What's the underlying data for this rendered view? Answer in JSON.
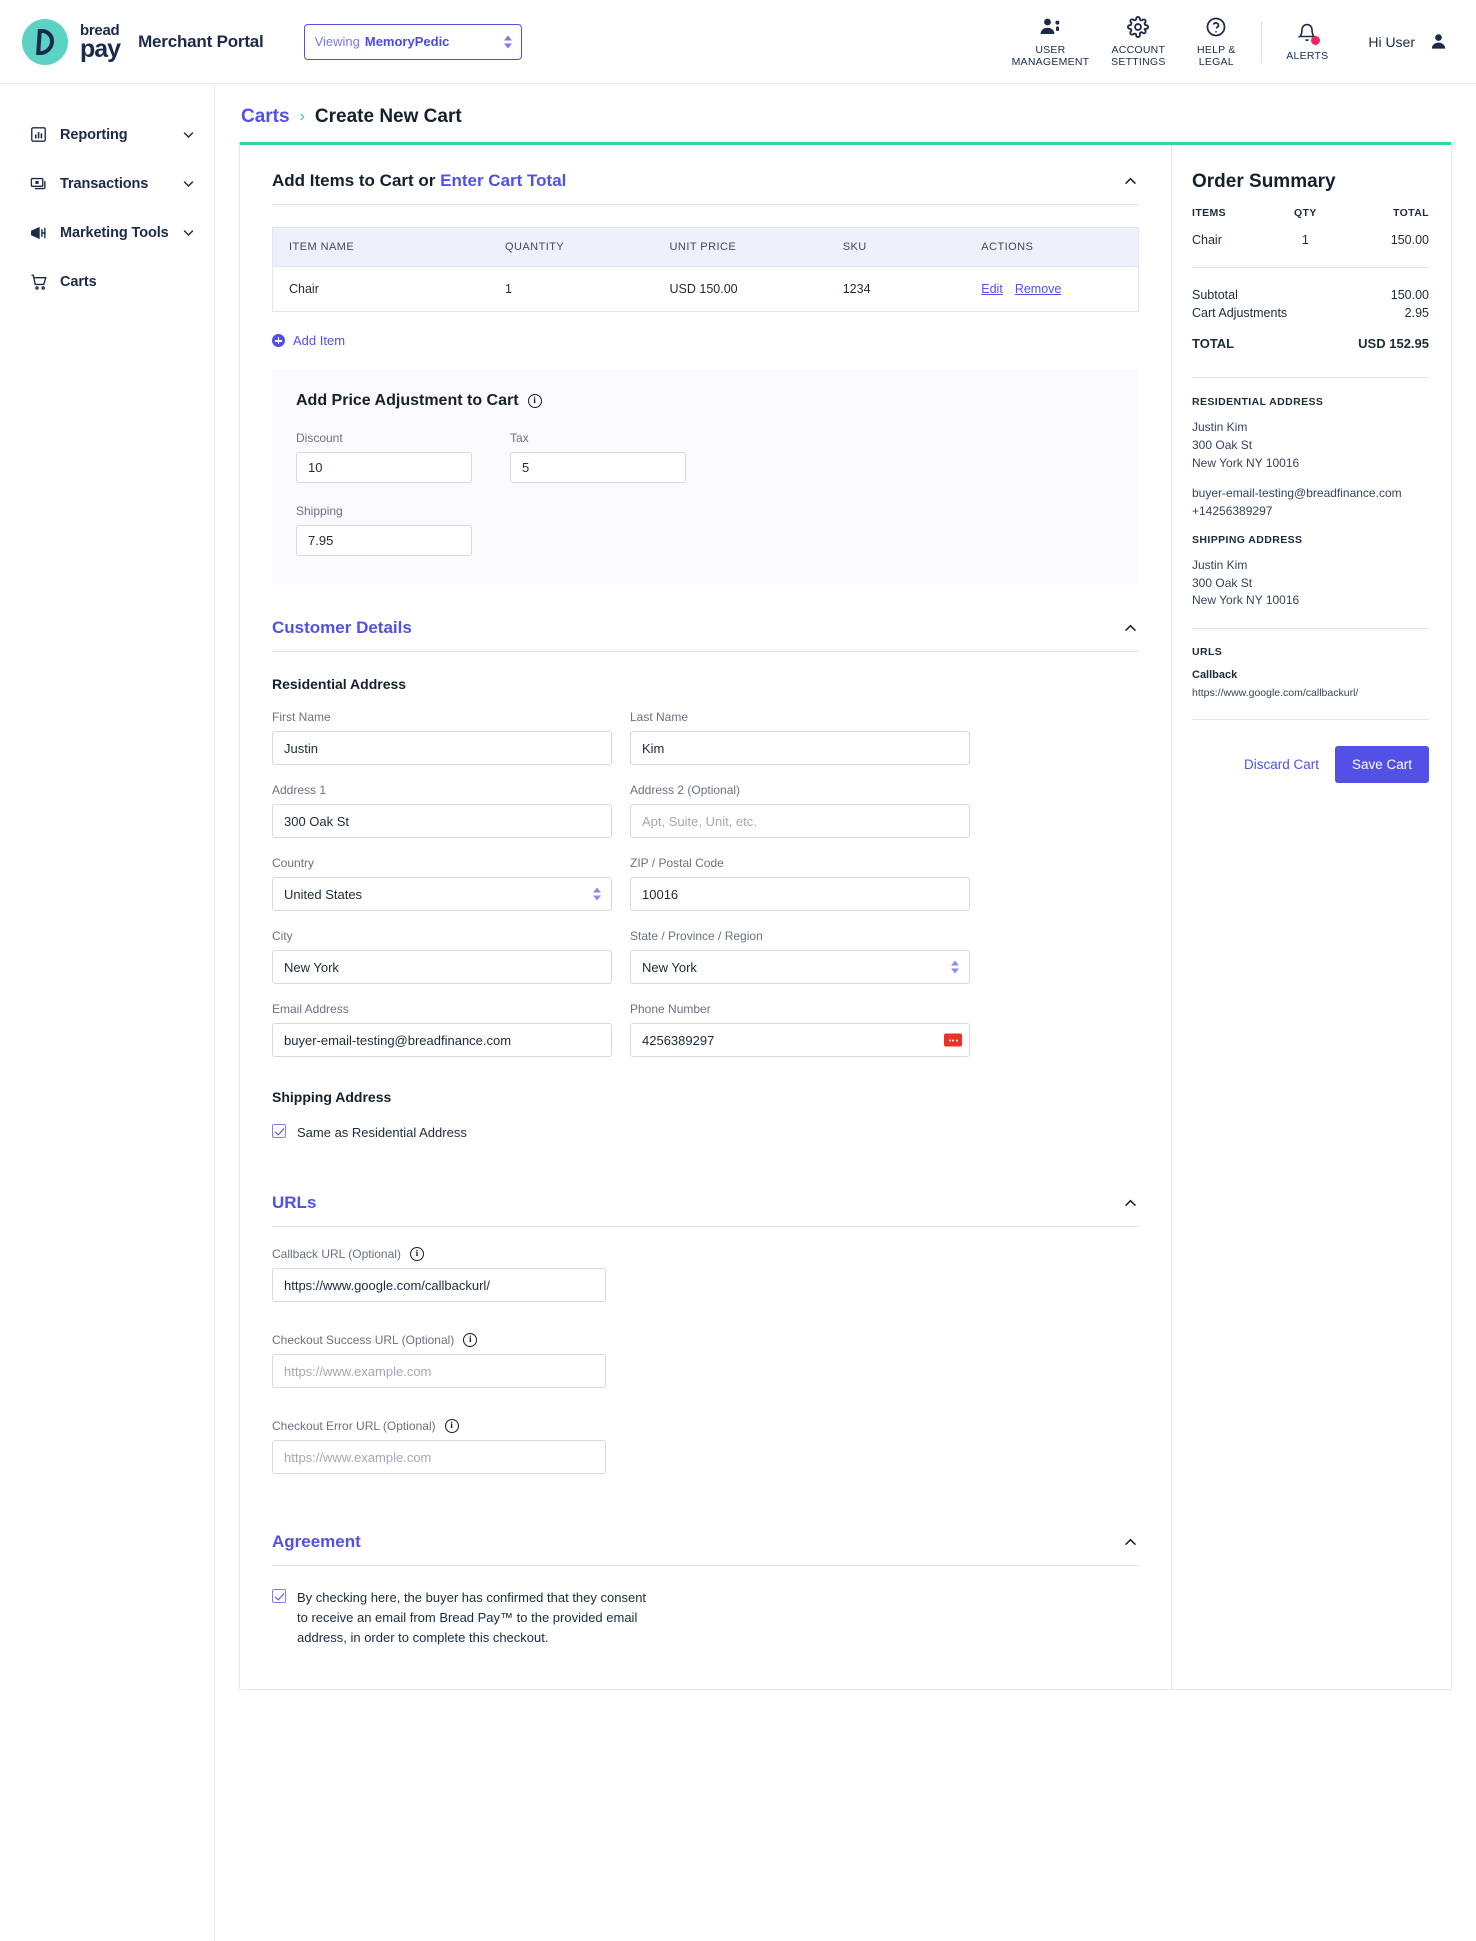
{
  "header": {
    "brand_word_top": "bread",
    "brand_word_bottom": "pay",
    "portal_title": "Merchant Portal",
    "viewing_label": "Viewing",
    "viewing_value": "MemoryPedic",
    "user_management": "USER\nMANAGEMENT",
    "user_management_l1": "USER",
    "user_management_l2": "MANAGEMENT",
    "account_settings_l1": "ACCOUNT",
    "account_settings_l2": "SETTINGS",
    "help_legal_l1": "HELP &",
    "help_legal_l2": "LEGAL",
    "alerts": "ALERTS",
    "greeting": "Hi User"
  },
  "sidebar": {
    "items": [
      {
        "label": "Reporting",
        "icon": "chart-bar-icon",
        "expandable": true
      },
      {
        "label": "Transactions",
        "icon": "transactions-icon",
        "expandable": true
      },
      {
        "label": "Marketing Tools",
        "icon": "megaphone-icon",
        "expandable": true
      },
      {
        "label": "Carts",
        "icon": "cart-icon",
        "expandable": false
      }
    ]
  },
  "breadcrumb": {
    "parent": "Carts",
    "separator": "›",
    "current": "Create New Cart"
  },
  "items_section": {
    "title_plain": "Add Items to Cart or ",
    "title_link": "Enter Cart Total",
    "columns": [
      "ITEM NAME",
      "QUANTITY",
      "UNIT PRICE",
      "SKU",
      "ACTIONS"
    ],
    "rows": [
      {
        "name": "Chair",
        "quantity": "1",
        "unit_price": "USD 150.00",
        "sku": "1234",
        "edit": "Edit",
        "remove": "Remove"
      }
    ],
    "add_item": "Add Item"
  },
  "price_adjustment": {
    "title": "Add Price Adjustment to Cart",
    "discount_label": "Discount",
    "discount_value": "10",
    "tax_label": "Tax",
    "tax_value": "5",
    "shipping_label": "Shipping",
    "shipping_value": "7.95"
  },
  "customer_details": {
    "title": "Customer Details",
    "residential_heading": "Residential Address",
    "first_name_label": "First Name",
    "first_name_value": "Justin",
    "last_name_label": "Last Name",
    "last_name_value": "Kim",
    "address1_label": "Address 1",
    "address1_value": "300 Oak St",
    "address2_label": "Address 2 (Optional)",
    "address2_placeholder": "Apt, Suite, Unit, etc.",
    "country_label": "Country",
    "country_value": "United States",
    "zip_label": "ZIP / Postal Code",
    "zip_value": "10016",
    "city_label": "City",
    "city_value": "New York",
    "state_label": "State / Province / Region",
    "state_value": "New York",
    "email_label": "Email Address",
    "email_value": "buyer-email-testing@breadfinance.com",
    "phone_label": "Phone Number",
    "phone_value": "4256389297",
    "shipping_heading": "Shipping Address",
    "same_as_residential": "Same as Residential Address"
  },
  "urls_section": {
    "title": "URLs",
    "callback_label": "Callback URL (Optional)",
    "callback_value": "https://www.google.com/callbackurl/",
    "success_label": "Checkout Success URL (Optional)",
    "success_placeholder": "https://www.example.com",
    "error_label": "Checkout Error URL (Optional)",
    "error_placeholder": "https://www.example.com"
  },
  "agreement_section": {
    "title": "Agreement",
    "text": "By checking here, the buyer has confirmed that they consent to receive an email from Bread Pay™ to the provided email address, in order to complete this checkout."
  },
  "order_summary": {
    "title": "Order Summary",
    "col_items": "ITEMS",
    "col_qty": "QTY",
    "col_total": "TOTAL",
    "rows": [
      {
        "name": "Chair",
        "qty": "1",
        "total": "150.00"
      }
    ],
    "subtotal_label": "Subtotal",
    "subtotal_value": "150.00",
    "adjustments_label": "Cart Adjustments",
    "adjustments_value": "2.95",
    "total_label": "TOTAL",
    "total_value": "USD 152.95",
    "residential_label": "RESIDENTIAL ADDRESS",
    "residential_name": "Justin Kim",
    "residential_street": "300 Oak St",
    "residential_citystate": "New York NY 10016",
    "residential_email": "buyer-email-testing@breadfinance.com",
    "residential_phone": "+14256389297",
    "shipping_label": "SHIPPING ADDRESS",
    "shipping_name": "Justin Kim",
    "shipping_street": "300 Oak St",
    "shipping_citystate": "New York NY 10016",
    "urls_label": "URLS",
    "callback_label": "Callback",
    "callback_value": "https://www.google.com/callbackurl/",
    "discard_button": "Discard Cart",
    "save_button": "Save Cart"
  },
  "colors": {
    "brand_teal": "#5bd2c4",
    "accent_purple": "#5250e6",
    "card_top_border": "#2fd4b0",
    "alert_red": "#f4245e",
    "navy": "#1b2a4a"
  }
}
